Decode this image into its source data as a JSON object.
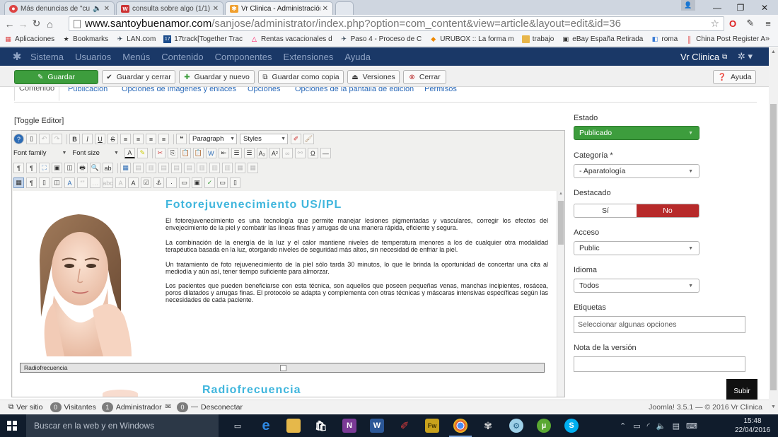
{
  "browser": {
    "tabs": [
      {
        "title": "Más denuncias de \"cu",
        "icon": "opera-mail-icon"
      },
      {
        "title": "consulta sobre algo (1/1)",
        "icon": "web-mail-icon"
      },
      {
        "title": "Vr Clinica - Administración",
        "icon": "joomla-icon"
      }
    ],
    "url_host": "www.santoybuenamor.com",
    "url_path": "/sanjose/administrator/index.php?option=com_content&view=article&layout=edit&id=36"
  },
  "bookmarks": [
    {
      "label": "Aplicaciones",
      "icon": "apps-grid-icon"
    },
    {
      "label": "Bookmarks",
      "icon": "star-icon"
    },
    {
      "label": "LAN.com",
      "icon": "plane-icon"
    },
    {
      "label": "17track[Together Trac",
      "icon": "track-icon"
    },
    {
      "label": "Rentas vacacionales d",
      "icon": "airbnb-icon"
    },
    {
      "label": "Paso 4 - Proceso de C",
      "icon": "plane-icon"
    },
    {
      "label": "URUBOX :: La forma m",
      "icon": "urubox-icon"
    },
    {
      "label": "trabajo",
      "icon": "folder-icon"
    },
    {
      "label": "eBay España Retirada",
      "icon": "ebay-icon"
    },
    {
      "label": "roma",
      "icon": "roma-icon"
    },
    {
      "label": "China Post Register A",
      "icon": "chinapost-icon"
    }
  ],
  "cms_menu": [
    "Sistema",
    "Usuarios",
    "Menús",
    "Contenido",
    "Componentes",
    "Extensiones",
    "Ayuda"
  ],
  "site_name": "Vr Clinica",
  "toolbar": {
    "save": "Guardar",
    "save_close": "Guardar y cerrar",
    "save_new": "Guardar y nuevo",
    "save_copy": "Guardar como copia",
    "versions": "Versiones",
    "close": "Cerrar",
    "help": "Ayuda"
  },
  "content_tabs": [
    "Contenido",
    "Publicación",
    "Opciones de imágenes y enlaces",
    "Opciones",
    "Opciones de la pantalla de edición",
    "Permisos"
  ],
  "editor": {
    "toggle": "[Toggle Editor]",
    "format_select": "Paragraph",
    "styles_select": "Styles",
    "font_family": "Font family",
    "font_size": "Font size",
    "article_title": "Fotorejuvenecimiento  US/IPL",
    "paragraphs": [
      "El fotorejuvenecimiento es una tecnología que permite manejar lesiones pigmentadas y vasculares, corregir los efectos del envejecimiento de la piel y combatir las líneas finas y arrugas de una manera rápida, eficiente y segura.",
      "La combinación de la energía de la luz y el calor mantiene niveles de temperatura menores a los de cualquier otra modalidad terapéutica basada en la luz, otorgando niveles de seguridad más altos, sin necesidad de enfriar la piel.",
      "Un tratamiento de foto rejuvenecimiento de la piel sólo tarda 30 minutos, lo que le brinda la oportunidad de concertar una cita al mediodía y aún así, tener tiempo suficiente para almorzar.",
      "Los pacientes que pueden beneficiarse con esta técnica, son aquellos que poseen pequeñas venas, manchas incipientes, rosácea, poros dilatados y arrugas finas. El protocolo se adapta y complementa con otras técnicas y máscaras intensivas específicas según las necesidades de cada paciente."
    ],
    "caption": "Radiofrecuencia",
    "next_title": "Radiofrecuencia"
  },
  "sidebar": {
    "estado_label": "Estado",
    "estado_value": "Publicado",
    "categoria_label": "Categoría *",
    "categoria_value": "- Aparatología",
    "destacado_label": "Destacado",
    "destacado_yes": "Sí",
    "destacado_no": "No",
    "acceso_label": "Acceso",
    "acceso_value": "Public",
    "idioma_label": "Idioma",
    "idioma_value": "Todos",
    "etiquetas_label": "Etiquetas",
    "etiquetas_placeholder": "Seleccionar algunas opciones",
    "nota_label": "Nota de la versión",
    "nota_value": ""
  },
  "subir": "Subir",
  "status": {
    "view_site": "Ver sitio",
    "visitors_count": "0",
    "visitors": "Visitantes",
    "admin_count": "1",
    "admin": "Administrador",
    "messages_count": "0",
    "logout": "Desconectar",
    "version": "Joomla! 3.5.1 — © 2016 Vr Clinica"
  },
  "taskbar": {
    "search_placeholder": "Buscar en la web y en Windows",
    "time": "15:48",
    "date": "22/04/2016"
  },
  "colors": {
    "navbar": "#1a3867",
    "green": "#3d9d3d",
    "red": "#b72a2a",
    "link": "#2a69b8",
    "title": "#40b6dd"
  }
}
